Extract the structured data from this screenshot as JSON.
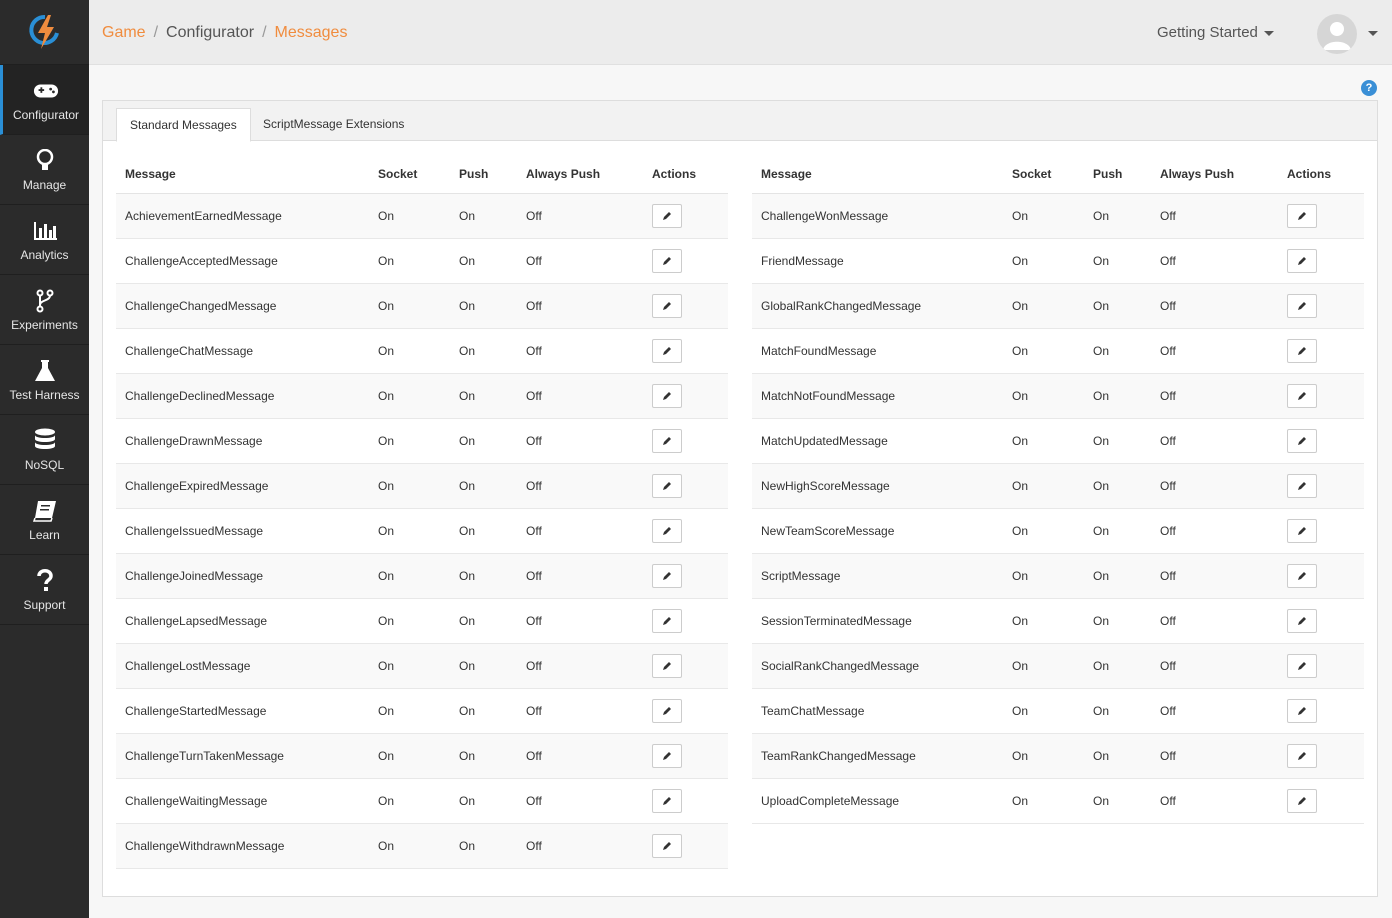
{
  "sidebar": {
    "items": [
      {
        "label": "Configurator",
        "icon": "gamepad-icon",
        "active": true
      },
      {
        "label": "Manage",
        "icon": "lightbulb-icon",
        "active": false
      },
      {
        "label": "Analytics",
        "icon": "bar-chart-icon",
        "active": false
      },
      {
        "label": "Experiments",
        "icon": "branch-icon",
        "active": false
      },
      {
        "label": "Test Harness",
        "icon": "flask-icon",
        "active": false
      },
      {
        "label": "NoSQL",
        "icon": "database-icon",
        "active": false
      },
      {
        "label": "Learn",
        "icon": "book-icon",
        "active": false
      },
      {
        "label": "Support",
        "icon": "question-icon",
        "active": false
      }
    ]
  },
  "breadcrumb": {
    "items": [
      "Game",
      "Configurator",
      "Messages"
    ]
  },
  "header": {
    "menu_label": "Getting Started"
  },
  "tabs": [
    {
      "label": "Standard Messages",
      "active": true
    },
    {
      "label": "ScriptMessage Extensions",
      "active": false
    }
  ],
  "table": {
    "columns": [
      "Message",
      "Socket",
      "Push",
      "Always Push",
      "Actions"
    ],
    "left_rows": [
      [
        "AchievementEarnedMessage",
        "On",
        "On",
        "Off"
      ],
      [
        "ChallengeAcceptedMessage",
        "On",
        "On",
        "Off"
      ],
      [
        "ChallengeChangedMessage",
        "On",
        "On",
        "Off"
      ],
      [
        "ChallengeChatMessage",
        "On",
        "On",
        "Off"
      ],
      [
        "ChallengeDeclinedMessage",
        "On",
        "On",
        "Off"
      ],
      [
        "ChallengeDrawnMessage",
        "On",
        "On",
        "Off"
      ],
      [
        "ChallengeExpiredMessage",
        "On",
        "On",
        "Off"
      ],
      [
        "ChallengeIssuedMessage",
        "On",
        "On",
        "Off"
      ],
      [
        "ChallengeJoinedMessage",
        "On",
        "On",
        "Off"
      ],
      [
        "ChallengeLapsedMessage",
        "On",
        "On",
        "Off"
      ],
      [
        "ChallengeLostMessage",
        "On",
        "On",
        "Off"
      ],
      [
        "ChallengeStartedMessage",
        "On",
        "On",
        "Off"
      ],
      [
        "ChallengeTurnTakenMessage",
        "On",
        "On",
        "Off"
      ],
      [
        "ChallengeWaitingMessage",
        "On",
        "On",
        "Off"
      ],
      [
        "ChallengeWithdrawnMessage",
        "On",
        "On",
        "Off"
      ]
    ],
    "right_rows": [
      [
        "ChallengeWonMessage",
        "On",
        "On",
        "Off"
      ],
      [
        "FriendMessage",
        "On",
        "On",
        "Off"
      ],
      [
        "GlobalRankChangedMessage",
        "On",
        "On",
        "Off"
      ],
      [
        "MatchFoundMessage",
        "On",
        "On",
        "Off"
      ],
      [
        "MatchNotFoundMessage",
        "On",
        "On",
        "Off"
      ],
      [
        "MatchUpdatedMessage",
        "On",
        "On",
        "Off"
      ],
      [
        "NewHighScoreMessage",
        "On",
        "On",
        "Off"
      ],
      [
        "NewTeamScoreMessage",
        "On",
        "On",
        "Off"
      ],
      [
        "ScriptMessage",
        "On",
        "On",
        "Off"
      ],
      [
        "SessionTerminatedMessage",
        "On",
        "On",
        "Off"
      ],
      [
        "SocialRankChangedMessage",
        "On",
        "On",
        "Off"
      ],
      [
        "TeamChatMessage",
        "On",
        "On",
        "Off"
      ],
      [
        "TeamRankChangedMessage",
        "On",
        "On",
        "Off"
      ],
      [
        "UploadCompleteMessage",
        "On",
        "On",
        "Off"
      ]
    ]
  },
  "colors": {
    "accent": "#f08c3e",
    "sidebar": "#2b2b2b",
    "active_border": "#2a8fd6"
  }
}
